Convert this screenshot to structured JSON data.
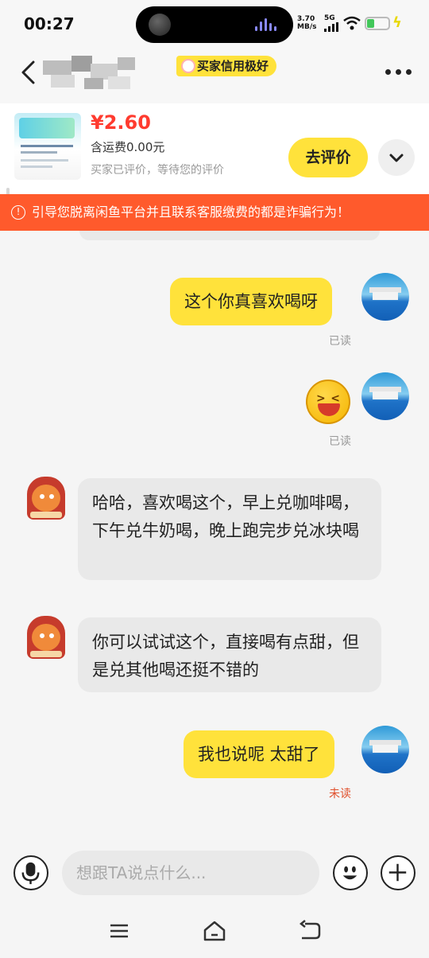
{
  "status_bar": {
    "time": "00:27",
    "net_speed_value": "3.70",
    "net_speed_unit": "MB/s",
    "network": "5G",
    "battery_level": 0.35,
    "colors": {
      "battery": "#42c75a",
      "charging_bolt": "#e8d800"
    }
  },
  "header": {
    "badge_label": "买家信用极好",
    "icons": {
      "back": "chevron-left-icon",
      "more": "more-dots-icon"
    }
  },
  "product": {
    "price": "¥2.60",
    "shipping": "含运费0.00元",
    "eval_status": "买家已评价，等待您的评价",
    "eval_button": "去评价",
    "icons": {
      "expand": "chevron-down-icon"
    }
  },
  "warning": {
    "icon": "!",
    "text": "引导您脱离闲鱼平台并且联系客服缴费的都是诈骗行为！"
  },
  "messages": [
    {
      "side": "me",
      "type": "text",
      "text": "这个你真喜欢喝呀",
      "status": "已读"
    },
    {
      "side": "me",
      "type": "emoji",
      "emoji": "laughing-face",
      "status": "已读"
    },
    {
      "side": "other",
      "type": "text",
      "text": "哈哈，喜欢喝这个，早上兑咖啡喝，下午兑牛奶喝，晚上跑完步兑冰块喝"
    },
    {
      "side": "other",
      "type": "text",
      "text": "你可以试试这个，直接喝有点甜，但是兑其他喝还挺不错的"
    },
    {
      "side": "me",
      "type": "text",
      "text": "我也说呢 太甜了",
      "status": "未读"
    }
  ],
  "input_bar": {
    "placeholder": "想跟TA说点什么...",
    "icons": {
      "voice": "microphone-icon",
      "emoji": "smiley-icon",
      "more": "plus-icon"
    }
  },
  "nav_bar": {
    "icons": [
      "menu-icon",
      "home-icon",
      "back-icon"
    ]
  },
  "colors": {
    "accent_yellow": "#ffe23b",
    "price_red": "#ff3b2f",
    "warning_orange": "#ff5a2c",
    "unread_red": "#e0502c"
  }
}
